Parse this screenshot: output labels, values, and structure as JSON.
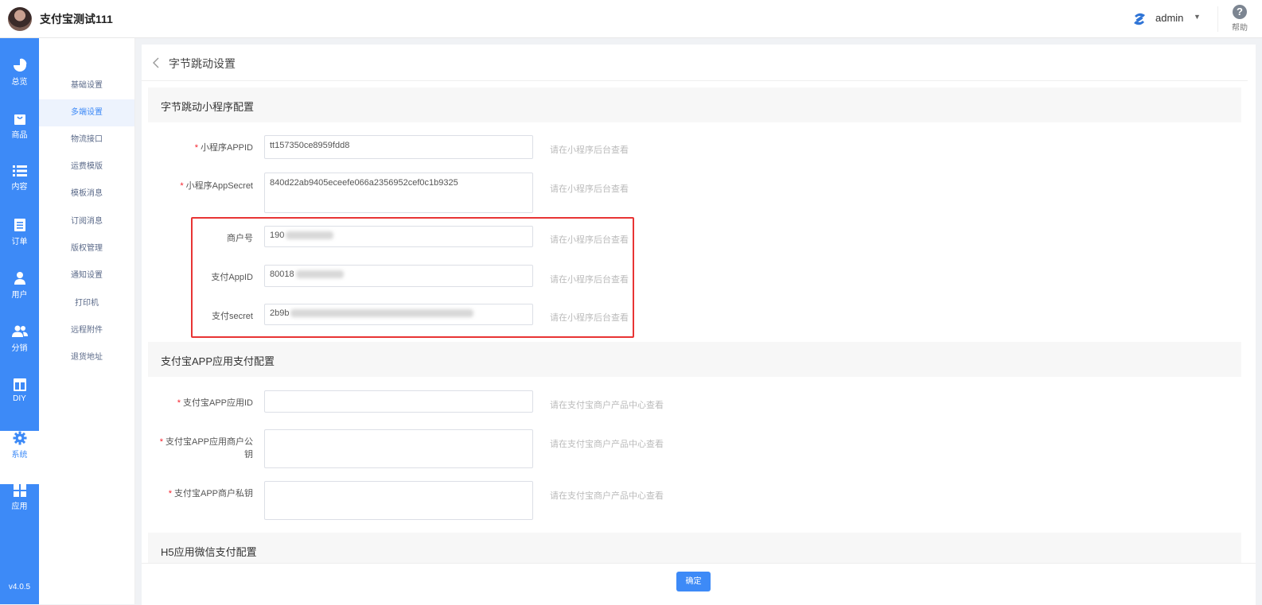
{
  "app": {
    "title": "支付宝测试111"
  },
  "user": {
    "name": "admin"
  },
  "help": {
    "label": "帮助"
  },
  "sidebar": {
    "items": [
      {
        "label": "总览",
        "icon": "pie-chart-icon"
      },
      {
        "label": "商品",
        "icon": "shopping-bag-icon"
      },
      {
        "label": "内容",
        "icon": "list-icon"
      },
      {
        "label": "订单",
        "icon": "document-icon"
      },
      {
        "label": "用户",
        "icon": "user-icon"
      },
      {
        "label": "分销",
        "icon": "users-icon"
      },
      {
        "label": "DIY",
        "icon": "layout-icon"
      },
      {
        "label": "系统",
        "icon": "gear-icon",
        "active": true
      },
      {
        "label": "应用",
        "icon": "grid-icon"
      }
    ],
    "version": "v4.0.5"
  },
  "submenu": {
    "items": [
      "基础设置",
      "多端设置",
      "物流接口",
      "运费模版",
      "模板消息",
      "订阅消息",
      "版权管理",
      "通知设置",
      "打印机",
      "远程附件",
      "退货地址"
    ],
    "active_index": 1
  },
  "page": {
    "title": "字节跳动设置"
  },
  "sections": {
    "bytedance": {
      "title": "字节跳动小程序配置",
      "fields": {
        "appid": {
          "label": "小程序APPID",
          "value": "tt157350ce8959fdd8",
          "hint": "请在小程序后台查看"
        },
        "appsecret": {
          "label": "小程序AppSecret",
          "value": "840d22ab9405eceefe066a2356952cef0c1b9325",
          "hint": "请在小程序后台查看"
        },
        "merchant_no": {
          "label": "商户号",
          "value": "190",
          "hint": "请在小程序后台查看"
        },
        "pay_appid": {
          "label": "支付AppID",
          "value": "80018",
          "hint": "请在小程序后台查看"
        },
        "pay_secret": {
          "label": "支付secret",
          "value": "2b9b",
          "hint": "请在小程序后台查看"
        }
      }
    },
    "alipay_app": {
      "title": "支付宝APP应用支付配置",
      "fields": {
        "app_id": {
          "label": "支付宝APP应用ID",
          "value": "",
          "hint": "请在支付宝商户产品中心查看"
        },
        "public_key_line1": "支付宝APP应用商户公",
        "public_key_line2": "钥",
        "public_key_hint": "请在支付宝商户产品中心查看",
        "private_key": {
          "label": "支付宝APP商户私钥",
          "value": "",
          "hint": "请在支付宝商户产品中心查看"
        }
      }
    },
    "h5": {
      "title": "H5应用微信支付配置"
    }
  },
  "footer": {
    "confirm_label": "确定"
  },
  "colors": {
    "primary": "#3d8af7",
    "highlight_border": "#e83434",
    "required": "#f5222d"
  }
}
